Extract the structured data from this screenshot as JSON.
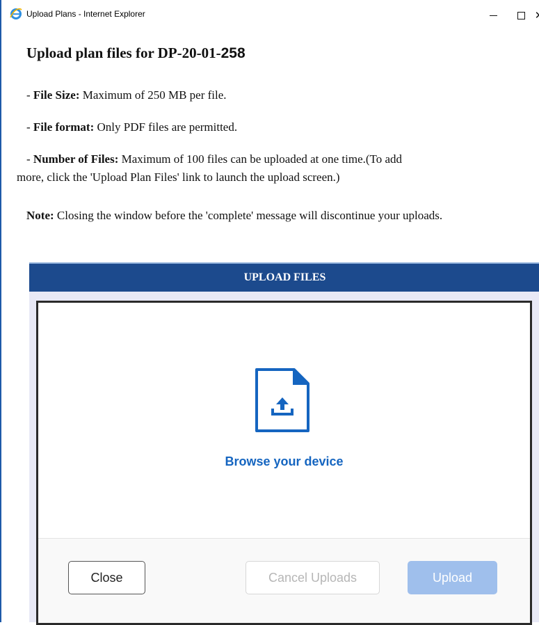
{
  "window": {
    "title": "Upload Plans - Internet Explorer",
    "icon": "internet-explorer-logo",
    "close_glyph": "✕"
  },
  "page": {
    "heading_prefix": "Upload plan files for DP-20-01-",
    "heading_number": "258",
    "rules": [
      {
        "label": "File Size:",
        "text": " Maximum of 250 MB per file."
      },
      {
        "label": "File format:",
        "text": " Only PDF files are permitted."
      },
      {
        "label": "Number of Files:",
        "text": " Maximum of 100 files can be uploaded at one time.(To add",
        "text2": "more, click the 'Upload Plan Files' link to launch the upload screen.)"
      }
    ],
    "note_label": "Note:",
    "note_text": " Closing the window before the 'complete' message will discontinue your uploads.",
    "dash": " - "
  },
  "uploader": {
    "header": "UPLOAD FILES",
    "browse_label": "Browse your device",
    "icon": "file-upload-icon",
    "buttons": {
      "close": "Close",
      "cancel": "Cancel Uploads",
      "upload": "Upload"
    },
    "colors": {
      "header_bg": "#1c4a8d",
      "link": "#1565c0",
      "upload_disabled": "#9fbfec"
    }
  }
}
